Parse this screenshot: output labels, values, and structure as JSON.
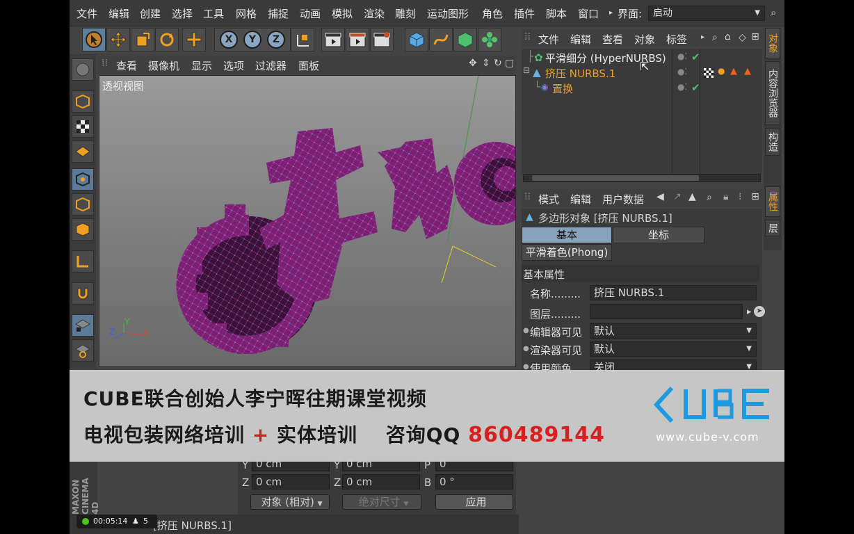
{
  "menu": [
    "文件",
    "编辑",
    "创建",
    "选择",
    "工具",
    "网格",
    "捕捉",
    "动画",
    "模拟",
    "渲染",
    "雕刻",
    "运动图形",
    "角色",
    "插件",
    "脚本",
    "窗口"
  ],
  "layout": {
    "label": "界面:",
    "value": "启动"
  },
  "axis_buttons": [
    "X",
    "Y",
    "Z"
  ],
  "viewport": {
    "menu": [
      "查看",
      "摄像机",
      "显示",
      "选项",
      "过滤器",
      "面板"
    ],
    "label": "透视视图",
    "axes": [
      "Y",
      "Z",
      "X"
    ]
  },
  "object_manager": {
    "menu": [
      "文件",
      "编辑",
      "查看",
      "对象",
      "标签"
    ],
    "rows": [
      {
        "name": "平滑细分 (HyperNURBS)",
        "color": "#e8e8e8"
      },
      {
        "name": "挤压 NURBS.1",
        "color": "#f0a020"
      },
      {
        "name": "置换",
        "color": "#f0a020"
      }
    ]
  },
  "right_tabs": [
    "对象",
    "内容浏览器",
    "构造",
    "属性",
    "层"
  ],
  "attributes": {
    "menu": [
      "模式",
      "编辑",
      "用户数据"
    ],
    "title": "多边形对象 [挤压 NURBS.1]",
    "tabs": [
      "基本",
      "坐标",
      "平滑着色(Phong)"
    ],
    "section": "基本属性",
    "props": [
      {
        "label": "名称.........",
        "value": "挤压 NURBS.1"
      },
      {
        "label": "图层.........",
        "value": ""
      },
      {
        "label": "编辑器可见",
        "value": "默认"
      },
      {
        "label": "渲染器可见",
        "value": "默认"
      },
      {
        "label": "使用颜色",
        "value": "关闭"
      }
    ]
  },
  "coordinates": {
    "row1": {
      "a": "Y",
      "av": "0 cm",
      "b": "Y",
      "bv": "0 cm",
      "c": "P",
      "cv": "0"
    },
    "row2": {
      "a": "Z",
      "av": "0 cm",
      "b": "Z",
      "bv": "0 cm",
      "c": "B",
      "cv": "0 °"
    },
    "mode": "对象 (相对)",
    "size_mode": "绝对尺寸",
    "apply": "应用"
  },
  "status_text": "[挤压 NURBS.1]",
  "recording": {
    "time": "00:05:14",
    "count": "5"
  },
  "banner": {
    "line1": "CUBE联合创始人李宁晖往期课堂视频",
    "line2a": "电视包装网络培训",
    "plus": "+",
    "line2b": "实体培训",
    "qq_label": "咨询QQ",
    "qq": "860489144",
    "url": "www.cube-v.com"
  },
  "brand_vertical": "MAXON CINEMA 4D",
  "colors": {
    "accent": "#f0a020",
    "selection": "#86a2bd",
    "mesh": "#7b1f72",
    "points": "#56c6e8",
    "qq": "#d82020"
  }
}
